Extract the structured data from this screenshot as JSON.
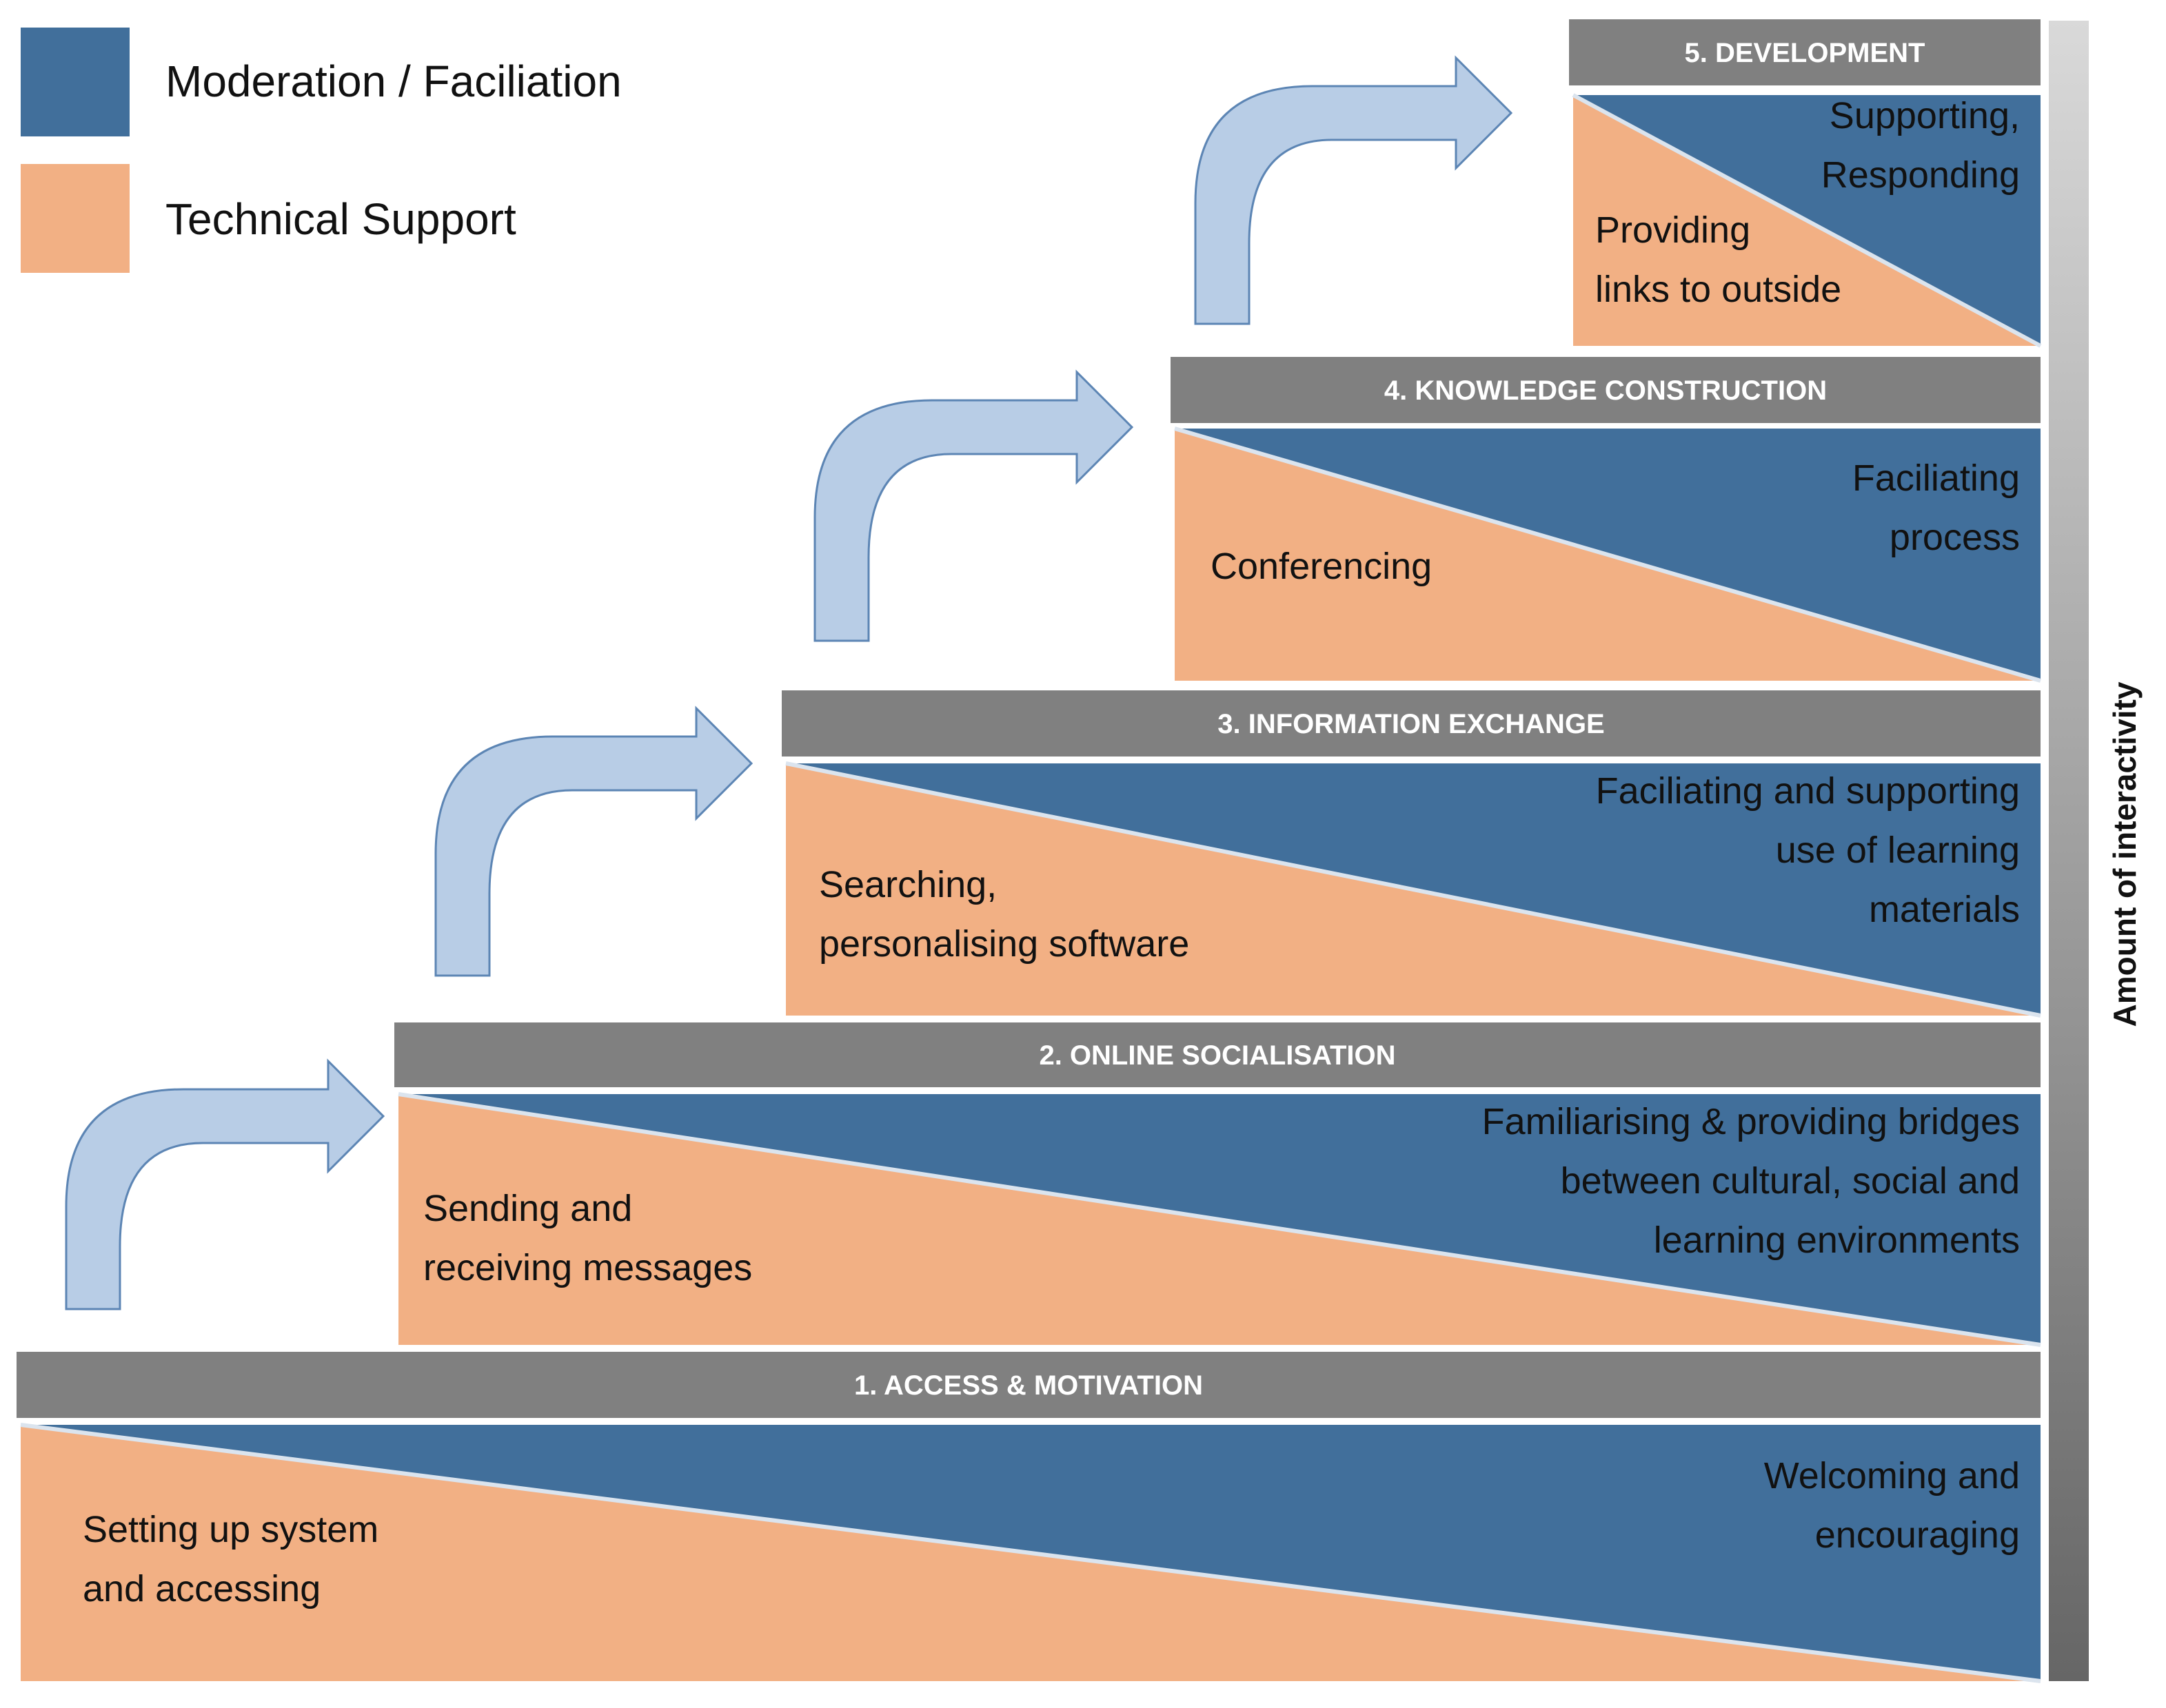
{
  "colors": {
    "moderation": "#416f9b",
    "technical": "#f2b084",
    "header": "#808080",
    "arrow_fill": "#b8cde6",
    "arrow_stroke": "#5c85b4",
    "divider": "#dbe4ee"
  },
  "legend": [
    {
      "label": "Moderation / Faciliation",
      "color_key": "moderation"
    },
    {
      "label": "Technical Support",
      "color_key": "technical"
    }
  ],
  "axis_label": "Amount of interactivity",
  "stages": [
    {
      "title": "1. ACCESS & MOTIVATION",
      "technical_lines": [
        "Setting up system",
        "and accessing"
      ],
      "moderation_lines": [
        "Welcoming and",
        "encouraging"
      ]
    },
    {
      "title": "2. ONLINE SOCIALISATION",
      "technical_lines": [
        "Sending and",
        "receiving messages"
      ],
      "moderation_lines": [
        "Familiarising & providing bridges",
        "between cultural, social and",
        "learning environments"
      ]
    },
    {
      "title": "3. INFORMATION EXCHANGE",
      "technical_lines": [
        "Searching,",
        "personalising software"
      ],
      "moderation_lines": [
        "Faciliating and supporting",
        "use of learning",
        "materials"
      ]
    },
    {
      "title": "4. KNOWLEDGE CONSTRUCTION",
      "technical_lines": [
        "Conferencing"
      ],
      "moderation_lines": [
        "Faciliating",
        "process"
      ]
    },
    {
      "title": "5. DEVELOPMENT",
      "technical_lines": [
        "Providing",
        "links to outside"
      ],
      "moderation_lines": [
        "Supporting,",
        "Responding"
      ]
    }
  ]
}
